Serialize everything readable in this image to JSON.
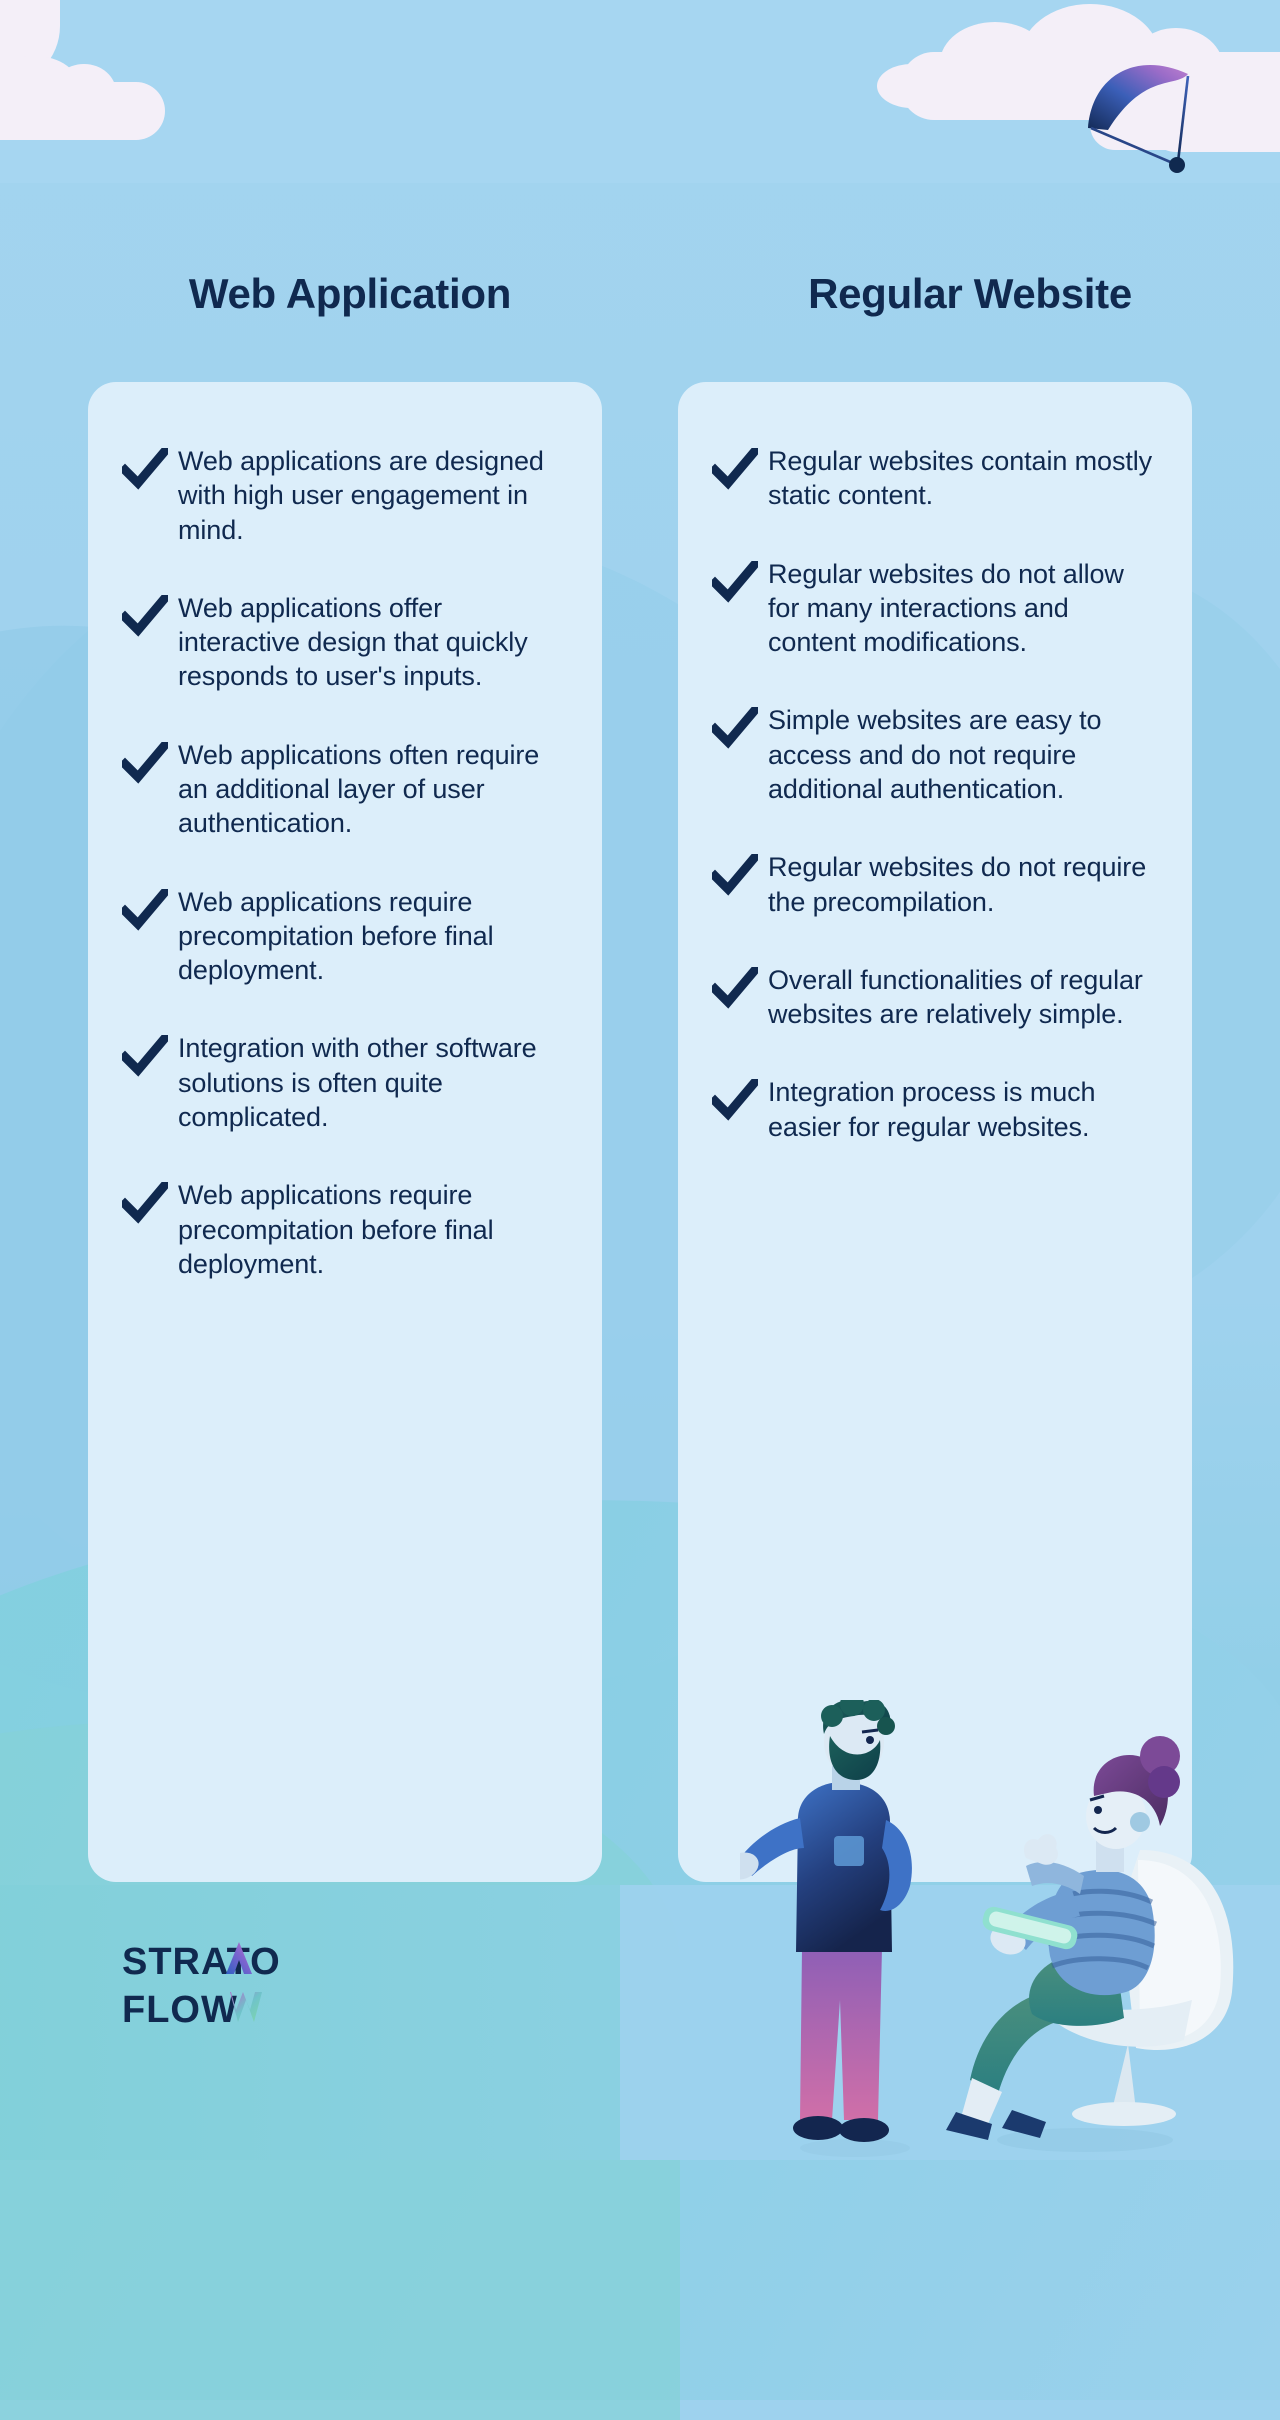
{
  "page": {
    "background_color": "#9ed2ee",
    "card_color": "#dceefa",
    "text_color": "#10294f"
  },
  "columns": [
    {
      "heading": "Web Application",
      "items": [
        "Web applications are designed with high user engagement in mind.",
        "Web applications offer interactive design that quickly responds to user's inputs.",
        "Web applications often require an additional layer of user authentication.",
        "Web applications require precompitation before final deployment.",
        "Integration with other software solutions is often quite complicated.",
        "Web applications require precompitation before final deployment."
      ]
    },
    {
      "heading": "Regular Website",
      "items": [
        "Regular websites contain mostly static content.",
        "Regular websites do not allow for many interactions and content modifications.",
        "Simple websites are easy to access and do not require additional authentication.",
        "Regular websites do not require the precompilation.",
        "Overall functionalities of regular websites are relatively simple.",
        "Integration process is much easier for regular websites."
      ]
    }
  ],
  "logo": {
    "line1": "STRATO",
    "line2": "FLOW",
    "accent_start": "#2f5fc4",
    "accent_end": "#b06ec8"
  },
  "decorations": {
    "paraglider": "paraglider-icon",
    "clouds": "cloud-icon",
    "people": "two-people-illustration",
    "check": "check-icon"
  }
}
